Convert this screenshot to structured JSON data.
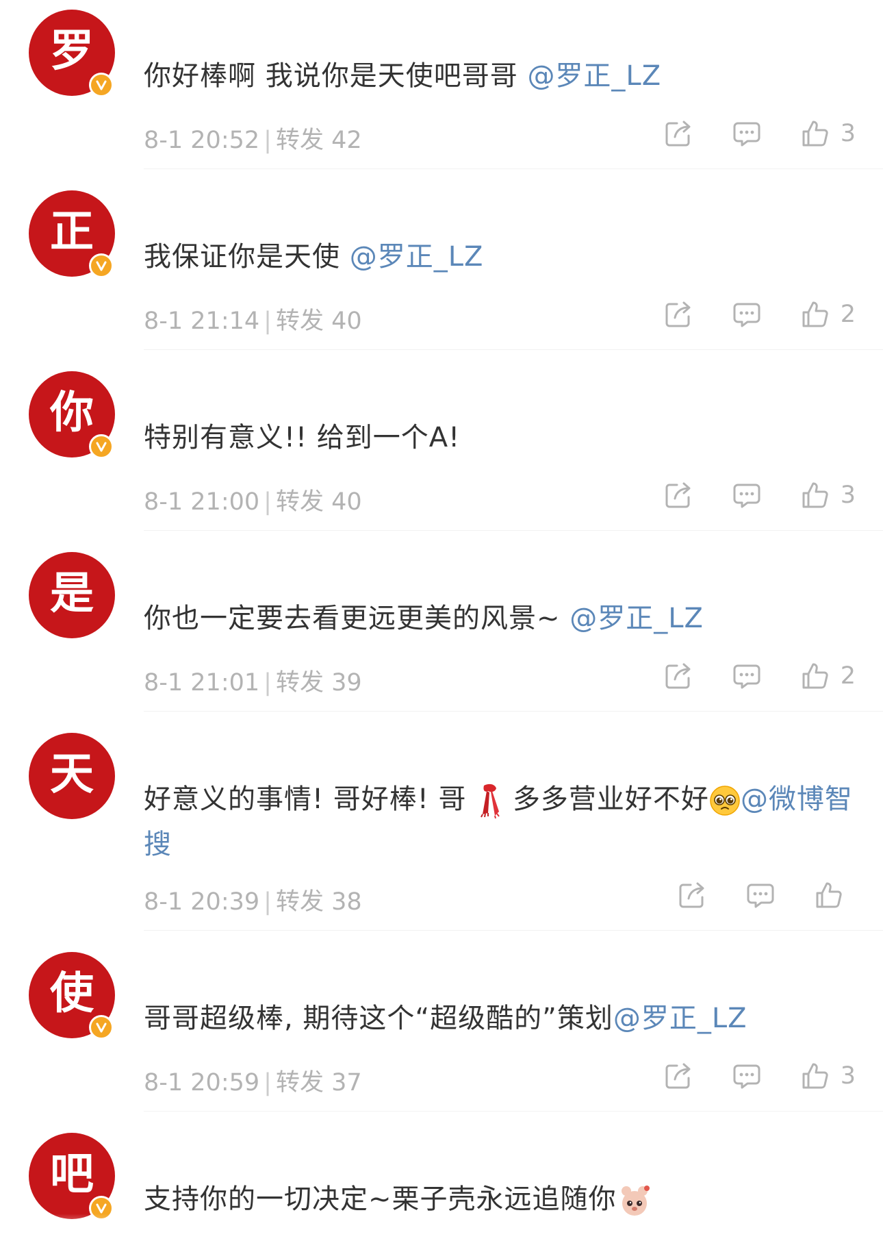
{
  "colors": {
    "avatar_bg": "#c6161a",
    "badge": "#f5a623",
    "mention": "#5b87b8",
    "meta": "#b3b3b3",
    "text": "#333333"
  },
  "icons": {
    "share": "share-icon",
    "comment": "comment-icon",
    "like": "thumbs-up-icon",
    "verified": "verified-badge-icon"
  },
  "posts": [
    {
      "avatar": "罗",
      "text": "你好棒啊 我说你是天使吧哥哥 ",
      "mention": "@罗正_LZ",
      "time": "8-1 20:52",
      "repost_label": "转发",
      "repost_count": "42",
      "likes": "3"
    },
    {
      "avatar": "正",
      "text": "我保证你是天使 ",
      "mention": "@罗正_LZ",
      "time": "8-1 21:14",
      "repost_label": "转发",
      "repost_count": "40",
      "likes": "2"
    },
    {
      "avatar": "你",
      "text": "特别有意义!! 给到一个A!",
      "mention": "",
      "time": "8-1 21:00",
      "repost_label": "转发",
      "repost_count": "40",
      "likes": "3"
    },
    {
      "avatar": "是",
      "text": "你也一定要去看更远更美的风景~ ",
      "mention": "@罗正_LZ",
      "time": "8-1 21:01",
      "repost_label": "转发",
      "repost_count": "39",
      "likes": "2"
    },
    {
      "avatar": "天",
      "text_part1": "好意义的事情! 哥好棒! 哥",
      "text_part2": "多多营业好不好",
      "mention": "@微博智搜",
      "time": "8-1 20:39",
      "repost_label": "转发",
      "repost_count": "38",
      "likes": ""
    },
    {
      "avatar": "使",
      "text": "哥哥超级棒, 期待这个“超级酷的”策划",
      "mention": "@罗正_LZ",
      "time": "8-1 20:59",
      "repost_label": "转发",
      "repost_count": "37",
      "likes": "3"
    },
    {
      "avatar": "吧",
      "text": "支持你的一切决定~栗子壳永远追随你",
      "mention": ""
    }
  ]
}
